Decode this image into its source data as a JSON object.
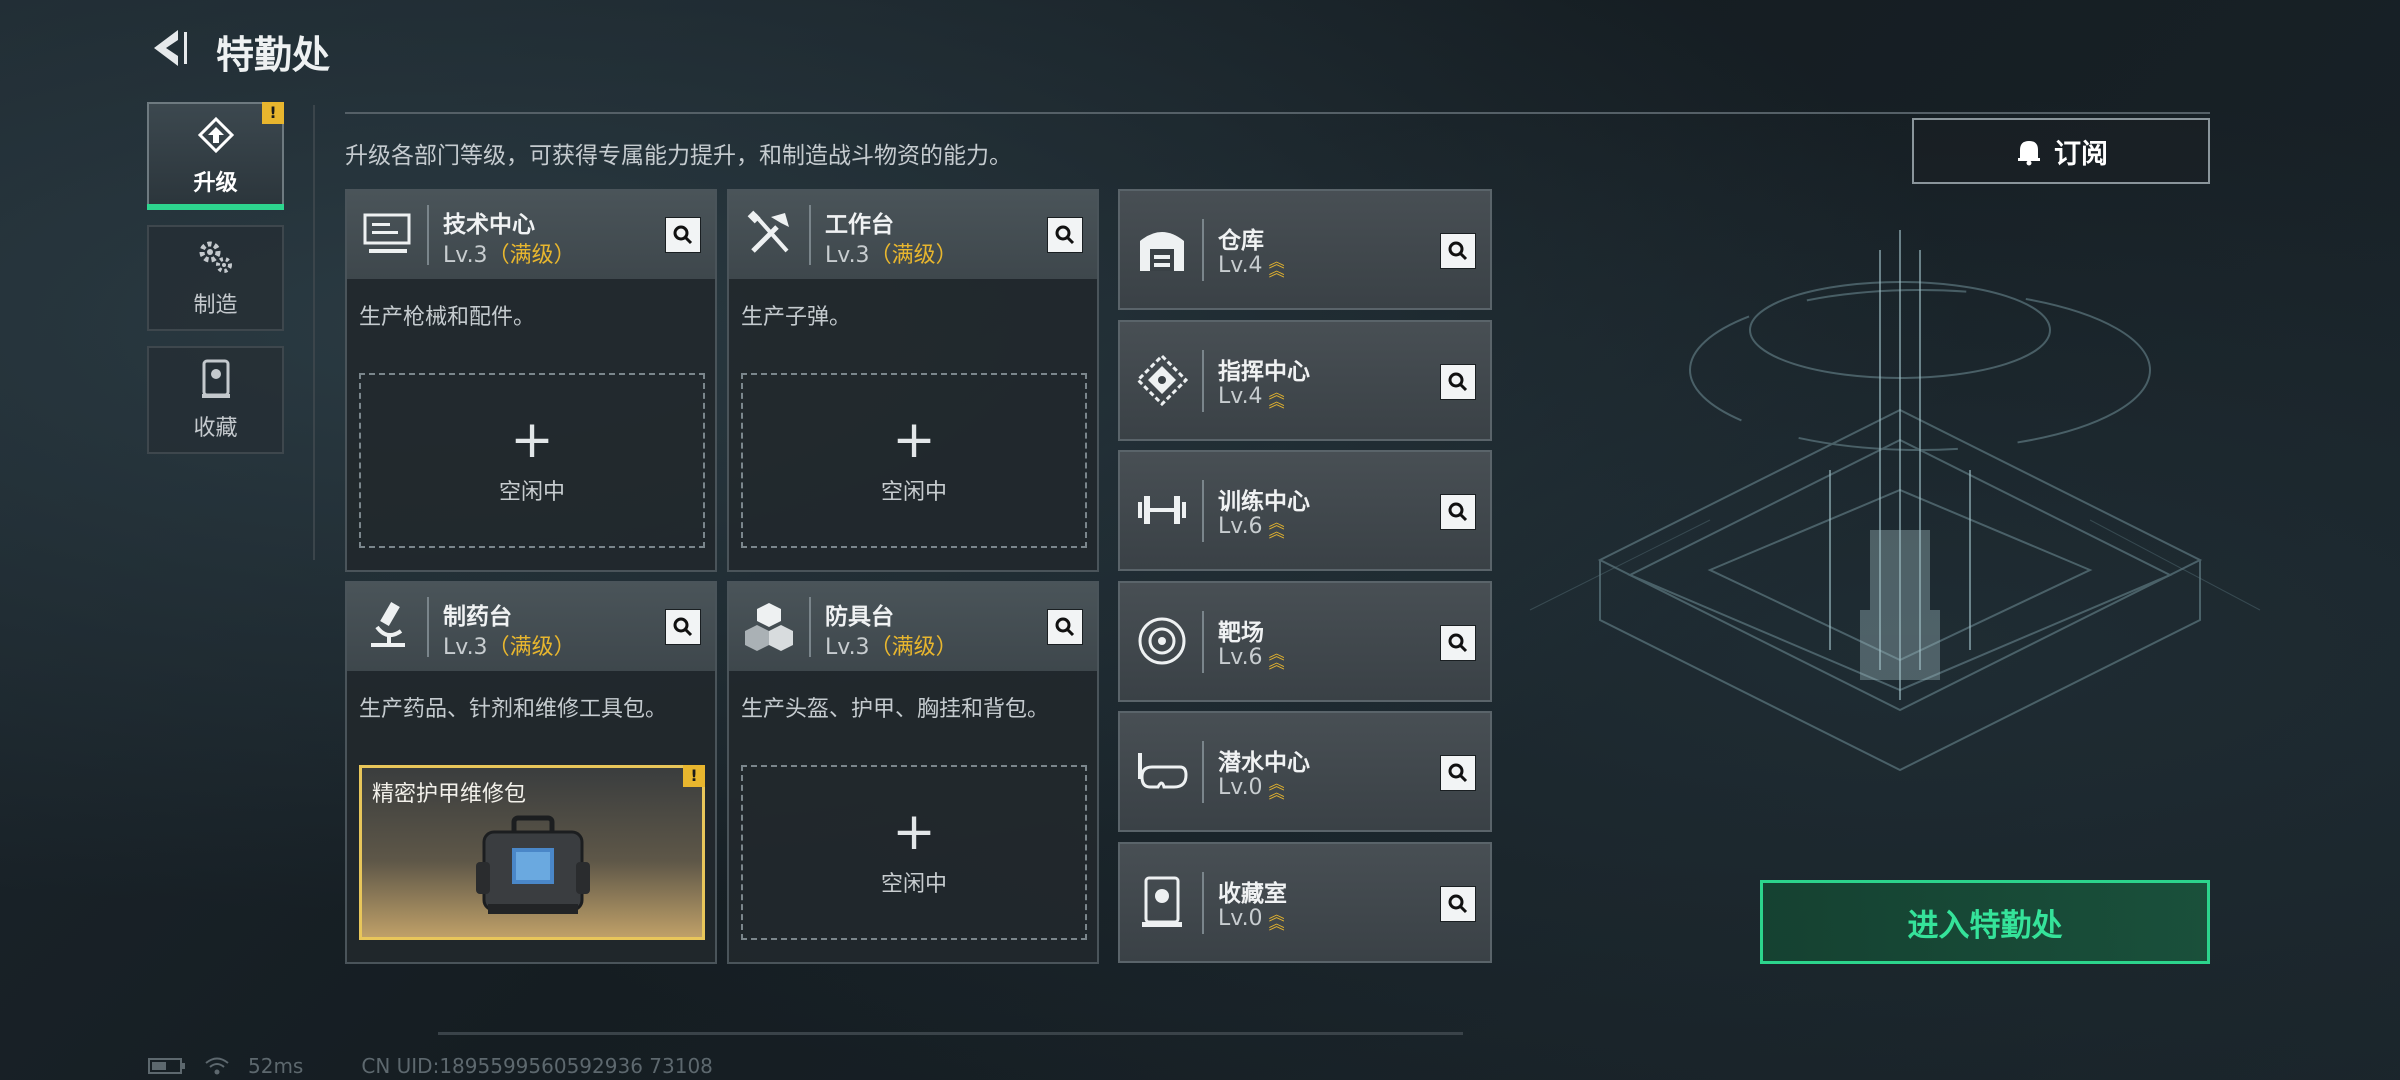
{
  "header": {
    "title": "特勤处"
  },
  "nav": [
    {
      "label": "升级",
      "icon": "upgrade-icon",
      "active": true,
      "alert": "!"
    },
    {
      "label": "制造",
      "icon": "gears-icon",
      "active": false
    },
    {
      "label": "收藏",
      "icon": "display-case-icon",
      "active": false
    }
  ],
  "intro": "升级各部门等级，可获得专属能力提升，和制造战斗物资的能力。",
  "facilities": [
    {
      "name": "技术中心",
      "level": "Lv.3",
      "max": "（满级）",
      "desc": "生产枪械和配件。",
      "slot": {
        "plus": "+",
        "label": "空闲中"
      },
      "icon": "computer-icon"
    },
    {
      "name": "工作台",
      "level": "Lv.3",
      "max": "（满级）",
      "desc": "生产子弹。",
      "slot": {
        "plus": "+",
        "label": "空闲中"
      },
      "icon": "tools-icon"
    },
    {
      "name": "制药台",
      "level": "Lv.3",
      "max": "（满级）",
      "desc": "生产药品、针剂和维修工具包。",
      "slot": {
        "item": "精密护甲维修包",
        "alert": "!"
      },
      "icon": "microscope-icon"
    },
    {
      "name": "防具台",
      "level": "Lv.3",
      "max": "（满级）",
      "desc": "生产头盔、护甲、胸挂和背包。",
      "slot": {
        "plus": "+",
        "label": "空闲中"
      },
      "icon": "armor-blocks-icon"
    }
  ],
  "departments": [
    {
      "name": "仓库",
      "level": "Lv.4",
      "icon": "warehouse-icon"
    },
    {
      "name": "指挥中心",
      "level": "Lv.4",
      "icon": "command-icon"
    },
    {
      "name": "训练中心",
      "level": "Lv.6",
      "icon": "dumbbell-icon"
    },
    {
      "name": "靶场",
      "level": "Lv.6",
      "icon": "target-icon"
    },
    {
      "name": "潜水中心",
      "level": "Lv.0",
      "icon": "diving-mask-icon"
    },
    {
      "name": "收藏室",
      "level": "Lv.0",
      "icon": "collection-room-icon"
    }
  ],
  "subscribe": {
    "label": "订阅"
  },
  "enter": {
    "label": "进入特勤处"
  },
  "status": {
    "ping": "52ms",
    "uid": "CN UID:1895599560592936 73108"
  },
  "colors": {
    "accent_green": "#2dd58e",
    "max_gold": "#e8b62e",
    "panel": "#3e474c"
  }
}
